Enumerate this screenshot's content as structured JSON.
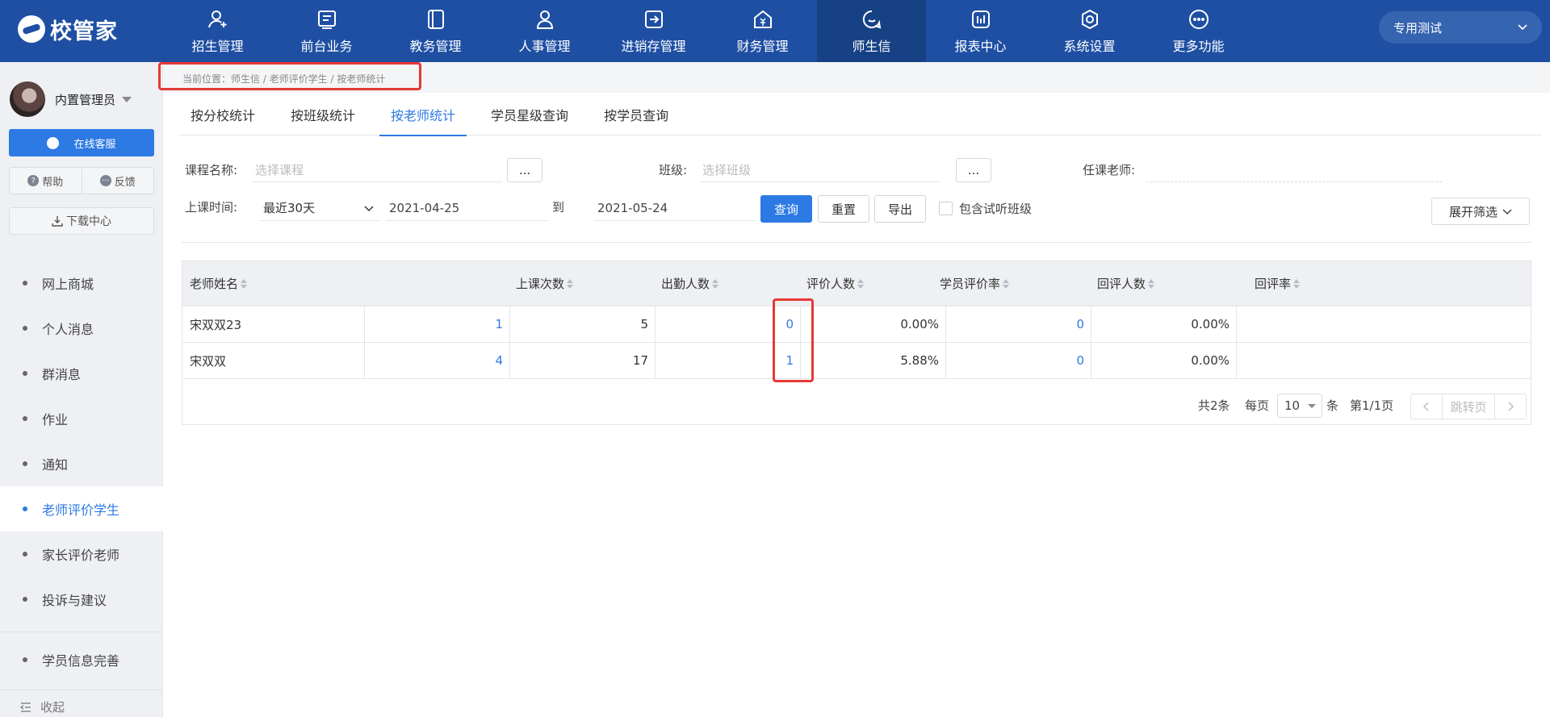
{
  "app": {
    "logo_text": "校管家",
    "tenant": "专用测试"
  },
  "nav": [
    {
      "label": "招生管理",
      "icon": "user-plus-icon"
    },
    {
      "label": "前台业务",
      "icon": "document-icon"
    },
    {
      "label": "教务管理",
      "icon": "book-icon"
    },
    {
      "label": "人事管理",
      "icon": "person-icon"
    },
    {
      "label": "进销存管理",
      "icon": "exchange-icon"
    },
    {
      "label": "财务管理",
      "icon": "yen-house-icon"
    },
    {
      "label": "师生信",
      "icon": "chat-icon",
      "active": true
    },
    {
      "label": "报表中心",
      "icon": "bar-chart-icon"
    },
    {
      "label": "系统设置",
      "icon": "settings-icon"
    },
    {
      "label": "更多功能",
      "icon": "more-icon"
    }
  ],
  "sidebar": {
    "user_name": "内置管理员",
    "service_label": "在线客服",
    "help_label": "帮助",
    "feedback_label": "反馈",
    "download_label": "下载中心",
    "items": [
      {
        "label": "网上商城"
      },
      {
        "label": "个人消息"
      },
      {
        "label": "群消息"
      },
      {
        "label": "作业"
      },
      {
        "label": "通知"
      },
      {
        "label": "老师评价学生",
        "active": true
      },
      {
        "label": "家长评价老师"
      },
      {
        "label": "投诉与建议"
      }
    ],
    "extra_item": "学员信息完善",
    "collapse_label": "收起"
  },
  "breadcrumb": "当前位置：师生信 / 老师评价学生 / 按老师统计",
  "tabs": [
    "按分校统计",
    "按班级统计",
    "按老师统计",
    "学员星级查询",
    "按学员查询"
  ],
  "active_tab": 2,
  "filters": {
    "course_label": "课程名称:",
    "course_placeholder": "选择课程",
    "class_label": "班级:",
    "class_placeholder": "选择班级",
    "teacher_label": "任课老师:",
    "dots": "...",
    "time_label": "上课时间:",
    "time_range": "最近30天",
    "date_from": "2021-04-25",
    "to_label": "到",
    "date_to": "2021-05-24",
    "query_btn": "查询",
    "reset_btn": "重置",
    "export_btn": "导出",
    "include_trial": "包含试听班级",
    "expand_btn": "展开筛选"
  },
  "table": {
    "headers": [
      "老师姓名",
      "上课次数",
      "出勤人数",
      "评价人数",
      "学员评价率",
      "回评人数",
      "回评率"
    ],
    "rows": [
      [
        "宋双双23",
        "1",
        "5",
        "0",
        "0.00%",
        "0",
        "0.00%"
      ],
      [
        "宋双双",
        "4",
        "17",
        "1",
        "5.88%",
        "0",
        "0.00%"
      ]
    ]
  },
  "pager": {
    "total": "共2条",
    "per_page": "每页",
    "page_size": "10",
    "unit": "条",
    "page_info": "第1/1页",
    "jump": "跳转页"
  },
  "colors": {
    "nav_bg": "#1e4fa3",
    "accent": "#2d7ae4",
    "highlight": "#e53935"
  }
}
